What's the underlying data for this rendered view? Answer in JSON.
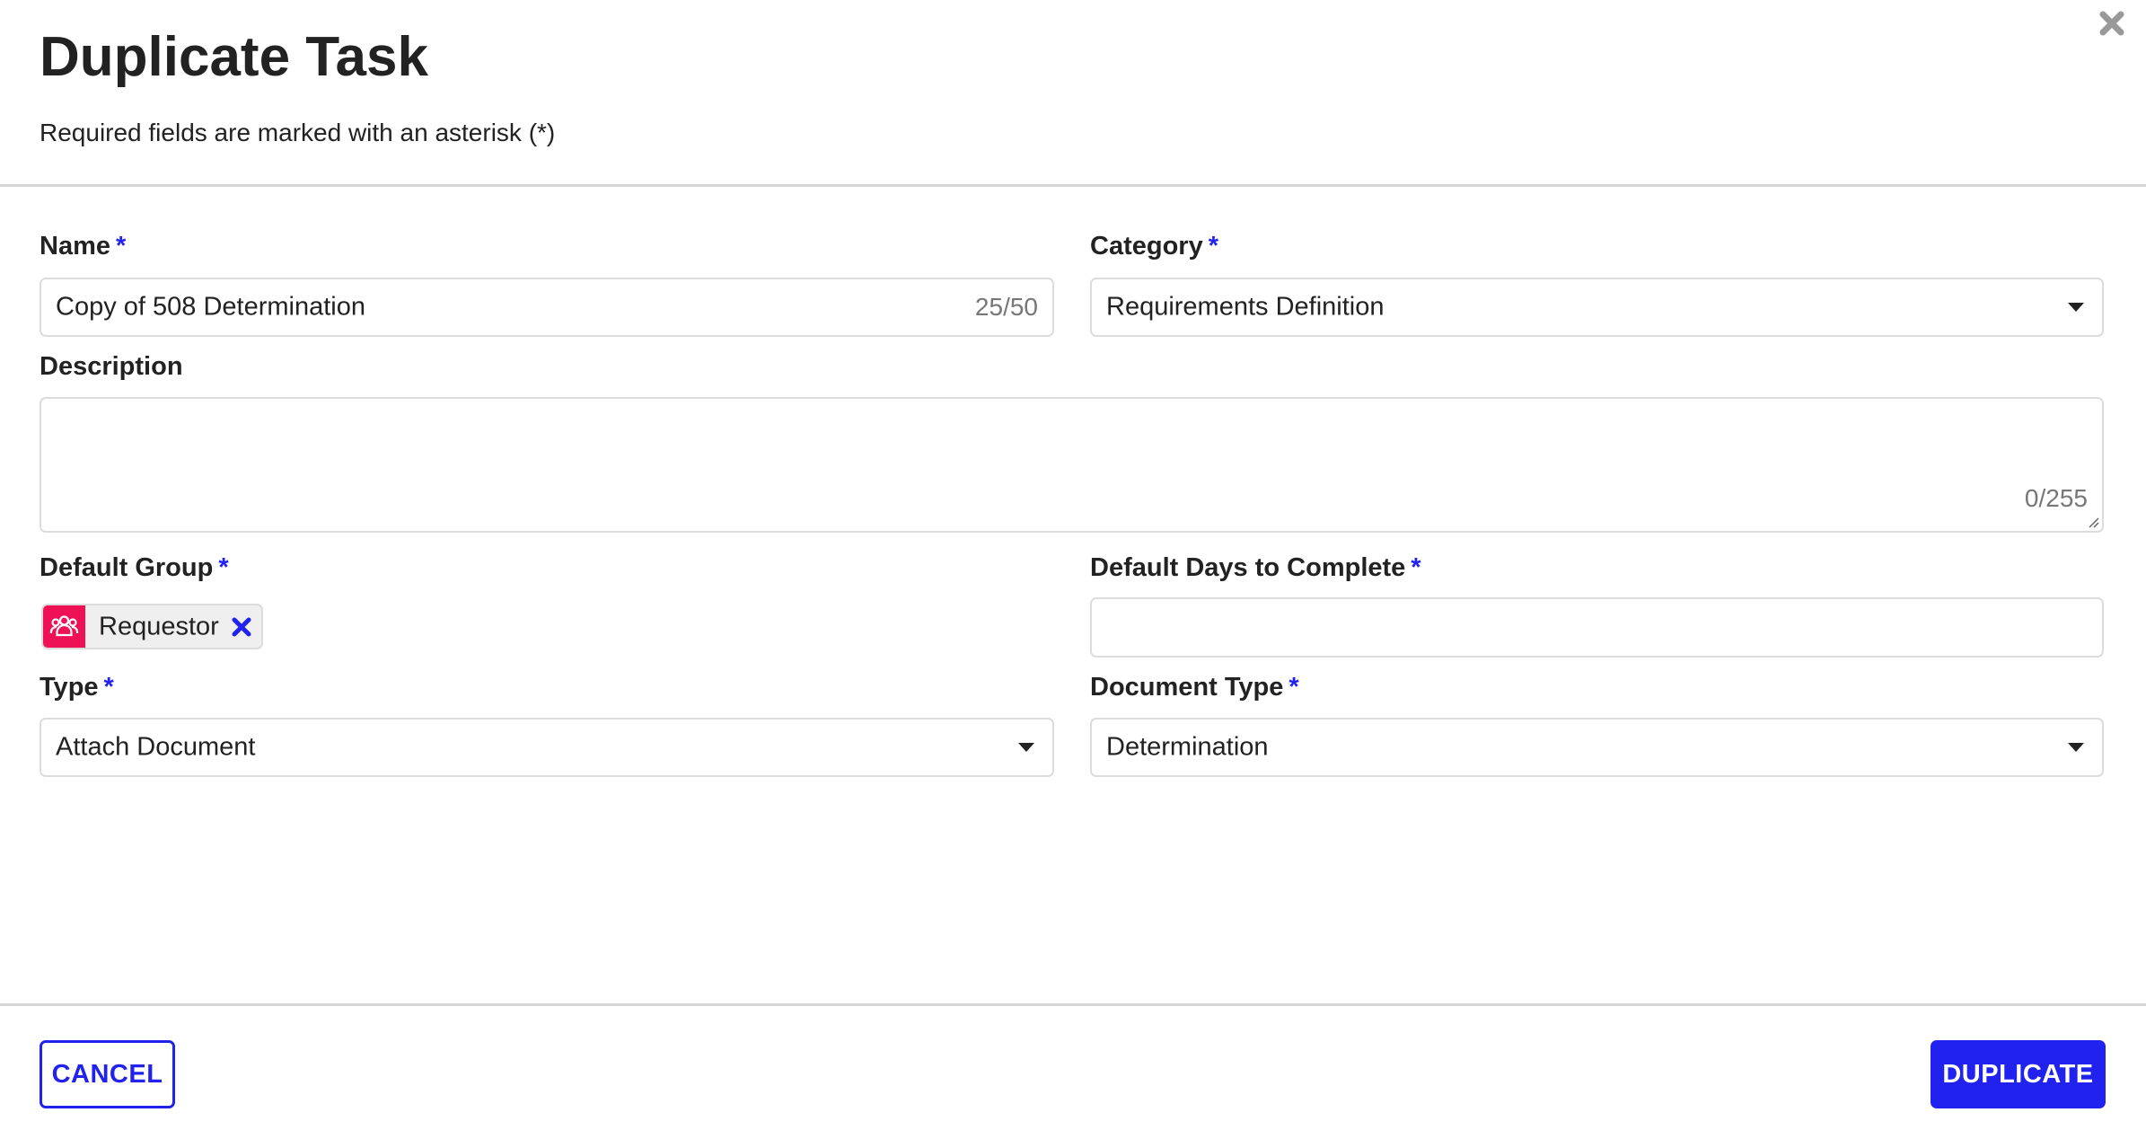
{
  "dialog": {
    "title": "Duplicate Task",
    "subtitle": "Required fields are marked with an asterisk (*)",
    "close_icon": "close-icon"
  },
  "form": {
    "required_marker": "*",
    "name": {
      "label": "Name",
      "value": "Copy of 508 Determination",
      "counter": "25/50"
    },
    "category": {
      "label": "Category",
      "value": "Requirements Definition"
    },
    "description": {
      "label": "Description",
      "value": "",
      "counter": "0/255"
    },
    "default_group": {
      "label": "Default Group",
      "chip_label": "Requestor",
      "chip_icon": "group-icon",
      "remove_icon": "remove-icon"
    },
    "default_days": {
      "label": "Default Days to Complete",
      "value": ""
    },
    "type": {
      "label": "Type",
      "value": "Attach Document"
    },
    "document_type": {
      "label": "Document Type",
      "value": "Determination"
    }
  },
  "footer": {
    "cancel_label": "CANCEL",
    "duplicate_label": "DUPLICATE"
  },
  "colors": {
    "accent": "#2222ee",
    "chip_icon_bg": "#ee1155",
    "border": "#dcdcdc"
  }
}
